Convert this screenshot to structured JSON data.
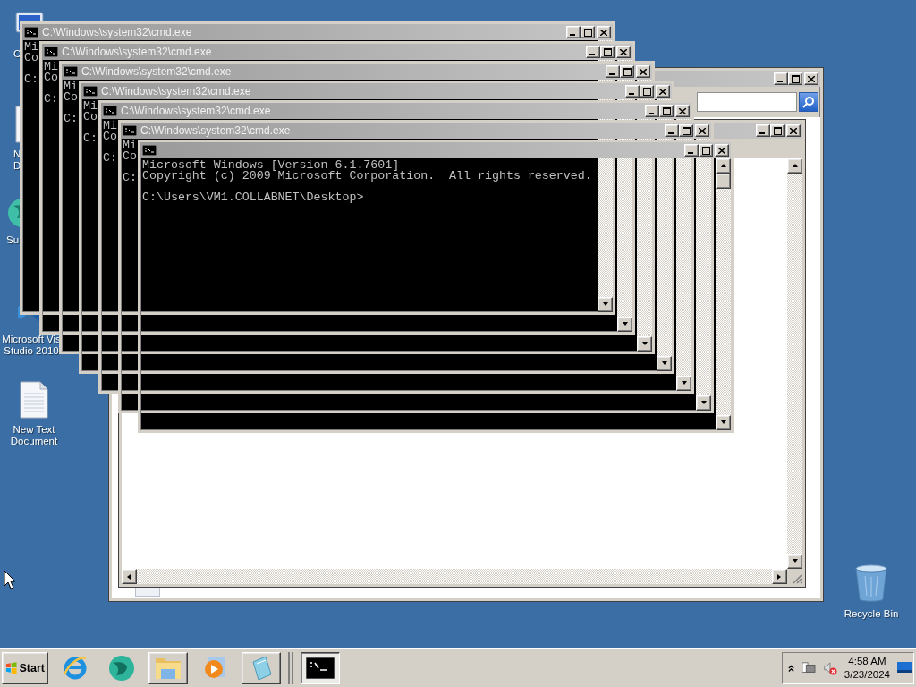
{
  "desktop_icons": [
    {
      "lines": [
        "C"
      ]
    },
    {
      "lines": [
        "N",
        "D"
      ]
    },
    {
      "lines": [
        "Su"
      ]
    },
    {
      "lines": [
        "Microsoft Vis",
        "Studio 2010"
      ]
    },
    {
      "lines": [
        "New Text",
        "Document"
      ]
    },
    {
      "lines": [
        "Recycle Bin"
      ]
    }
  ],
  "consoles": [
    {
      "title": "C:\\Windows\\system32\\cmd.exe",
      "lines": [
        "Mi",
        "Co"
      ],
      "prompt": "C:"
    },
    {
      "title": "C:\\Windows\\system32\\cmd.exe",
      "lines": [
        "Mi",
        "Co"
      ],
      "prompt": "C:"
    },
    {
      "title": "C:\\Windows\\system32\\cmd.exe",
      "lines": [
        "Mi",
        "Co"
      ],
      "prompt": "C:"
    },
    {
      "title": "C:\\Windows\\system32\\cmd.exe",
      "lines": [
        "Mi",
        "Co"
      ],
      "prompt": "C:"
    },
    {
      "title": "C:\\Windows\\system32\\cmd.exe",
      "lines": [
        "Mi",
        "Co"
      ],
      "prompt": "C:"
    },
    {
      "title": "C:\\Windows\\system32\\cmd.exe",
      "lines": [
        "Mi",
        "Co"
      ],
      "prompt": "C:"
    },
    {
      "lines": [
        "Microsoft Windows [Version 6.1.7601]",
        "Copyright (c) 2009 Microsoft Corporation.  All rights reserved."
      ],
      "prompt": "C:\\Users\\VM1.COLLABNET\\Desktop>"
    }
  ],
  "taskbar": {
    "start": "Start",
    "items": [
      {
        "kind": "launcher",
        "selected": false
      },
      {
        "kind": "launcher",
        "selected": false
      },
      {
        "kind": "window",
        "selected": false
      },
      {
        "kind": "launcher",
        "selected": false
      },
      {
        "kind": "window",
        "selected": false
      },
      {
        "kind": "window",
        "selected": true
      }
    ],
    "clock": {
      "time": "4:58 AM",
      "date": "3/23/2024"
    }
  }
}
